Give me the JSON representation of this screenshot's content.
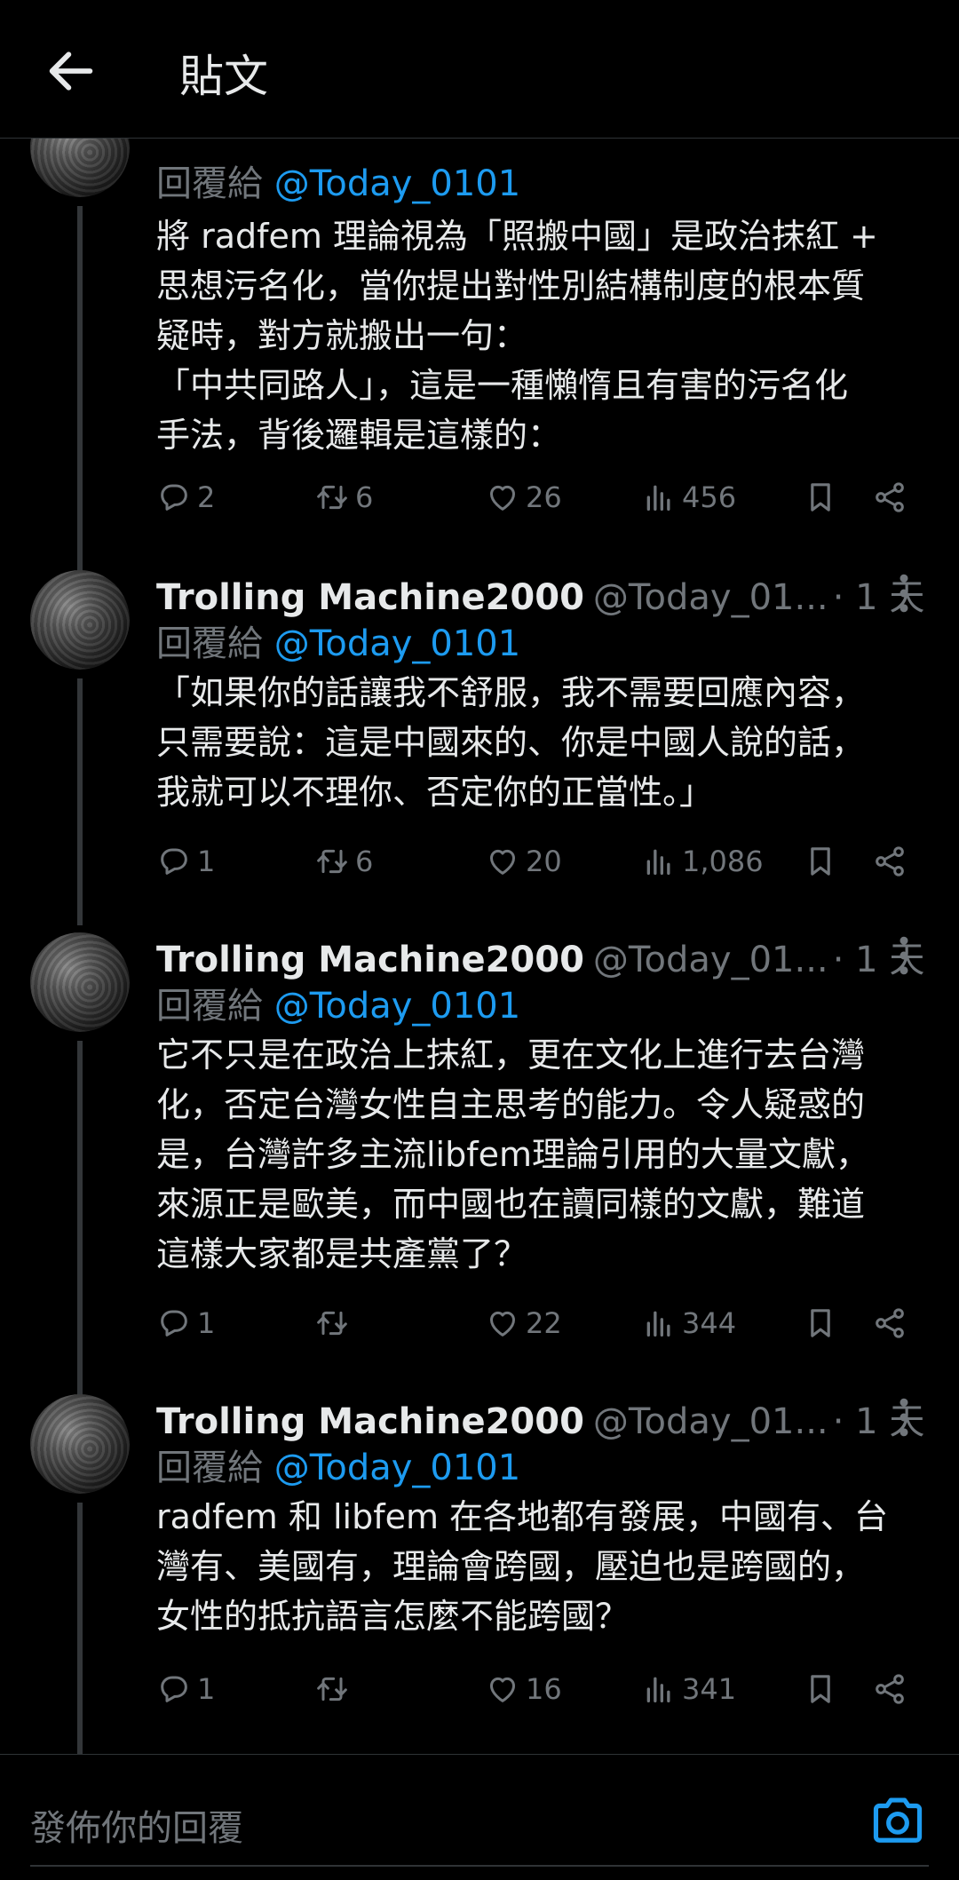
{
  "header": {
    "title": "貼文"
  },
  "tweets": [
    {
      "name": "",
      "handle": "",
      "time": "",
      "reply_prefix": "回覆給",
      "reply_handle": "@Today_0101",
      "text": "將 radfem 理論視為「照搬中國」是政治抹紅 +\n思想污名化，當你提出對性別結構制度的根本質\n疑時，對方就搬出一句：\n「中共同路人」，這是一種懶惰且有害的污名化\n手法，背後邏輯是這樣的：",
      "replies": "2",
      "retweets": "6",
      "likes": "26",
      "views": "456"
    },
    {
      "name": "Trolling Machine2000",
      "handle": "@Today_01...",
      "time": "· 1 天",
      "reply_prefix": "回覆給",
      "reply_handle": "@Today_0101",
      "text": "「如果你的話讓我不舒服，我不需要回應內容，\n只需要說：這是中國來的、你是中國人說的話，\n我就可以不理你、否定你的正當性。」",
      "replies": "1",
      "retweets": "6",
      "likes": "20",
      "views": "1,086"
    },
    {
      "name": "Trolling Machine2000",
      "handle": "@Today_01...",
      "time": "· 1 天",
      "reply_prefix": "回覆給",
      "reply_handle": "@Today_0101",
      "text": "它不只是在政治上抹紅，更在文化上進行去台灣\n化，否定台灣女性自主思考的能力。令人疑惑的\n是，台灣許多主流libfem理論引用的大量文獻，\n來源正是歐美，而中國也在讀同樣的文獻，難道\n這樣大家都是共產黨了？",
      "replies": "1",
      "retweets": "",
      "likes": "22",
      "views": "344"
    },
    {
      "name": "Trolling Machine2000",
      "handle": "@Today_01...",
      "time": "· 1 天",
      "reply_prefix": "回覆給",
      "reply_handle": "@Today_0101",
      "text": "radfem 和 libfem 在各地都有發展，中國有、台\n灣有、美國有，理論會跨國，壓迫也是跨國的，\n女性的抵抗語言怎麼不能跨國？",
      "replies": "1",
      "retweets": "",
      "likes": "16",
      "views": "341"
    }
  ],
  "reply_bar": {
    "placeholder": "發佈你的回覆"
  },
  "colors": {
    "accent": "#1d9bf0",
    "muted": "#71767b",
    "text": "#e7e9ea",
    "background": "#000000"
  }
}
